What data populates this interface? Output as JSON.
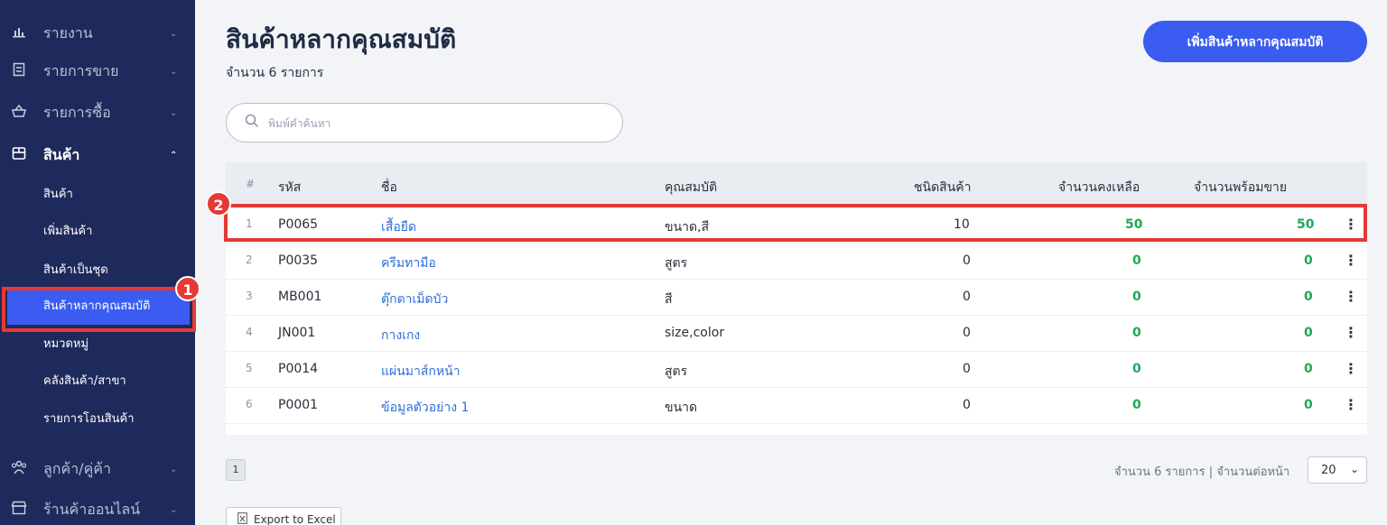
{
  "sidebar": {
    "groups": [
      {
        "icon": "chart-icon",
        "label": "รายงาน"
      },
      {
        "icon": "receipt-icon",
        "label": "รายการขาย"
      },
      {
        "icon": "basket-icon",
        "label": "รายการซื้อ"
      },
      {
        "icon": "box-icon",
        "label": "สินค้า"
      },
      {
        "icon": "users-icon",
        "label": "ลูกค้า/คู่ค้า"
      },
      {
        "icon": "store-icon",
        "label": "ร้านค้าออนไลน์"
      }
    ],
    "products_sub": [
      {
        "label": "สินค้า"
      },
      {
        "label": "เพิ่มสินค้า"
      },
      {
        "label": "สินค้าเป็นชุด"
      },
      {
        "label": "สินค้าหลากคุณสมบัติ"
      },
      {
        "label": "หมวดหมู่"
      },
      {
        "label": "คลังสินค้า/สาขา"
      },
      {
        "label": "รายการโอนสินค้า"
      }
    ]
  },
  "callouts": [
    "1",
    "2"
  ],
  "header": {
    "title": "สินค้าหลากคุณสมบัติ",
    "count": "จำนวน 6 รายการ",
    "add_button": "เพิ่มสินค้าหลากคุณสมบัติ"
  },
  "search": {
    "placeholder": "พิมพ์คำค้นหา"
  },
  "table": {
    "headers": [
      "#",
      "รหัส",
      "ชื่อ",
      "คุณสมบัติ",
      "ชนิดสินค้า",
      "จำนวนคงเหลือ",
      "จำนวนพร้อมขาย"
    ],
    "rows": [
      {
        "n": "1",
        "code": "P0065",
        "name": "เสื้อยืด",
        "attrs": "ขนาด,สี",
        "types": "10",
        "stock": "50",
        "ready": "50"
      },
      {
        "n": "2",
        "code": "P0035",
        "name": "ครีมทามือ",
        "attrs": "สูตร",
        "types": "0",
        "stock": "0",
        "ready": "0"
      },
      {
        "n": "3",
        "code": "MB001",
        "name": "ตุ๊กตาเม็ดบัว",
        "attrs": "สี",
        "types": "0",
        "stock": "0",
        "ready": "0"
      },
      {
        "n": "4",
        "code": "JN001",
        "name": "กางเกง",
        "attrs": "size,color",
        "types": "0",
        "stock": "0",
        "ready": "0"
      },
      {
        "n": "5",
        "code": "P0014",
        "name": "แผ่นมาส์กหน้า",
        "attrs": "สูตร",
        "types": "0",
        "stock": "0",
        "ready": "0"
      },
      {
        "n": "6",
        "code": "P0001",
        "name": "ข้อมูลตัวอย่าง 1",
        "attrs": "ขนาด",
        "types": "0",
        "stock": "0",
        "ready": "0"
      }
    ]
  },
  "footer": {
    "page": "1",
    "summary": "จำนวน 6 รายการ | จำนวนต่อหน้า",
    "per_page": "20",
    "export": "Export to Excel"
  },
  "colors": {
    "sidebar": "#1f2a5c",
    "accent": "#3a5cf0",
    "callout": "#e53935",
    "positive": "#1fa855",
    "link": "#2f6fd6"
  }
}
